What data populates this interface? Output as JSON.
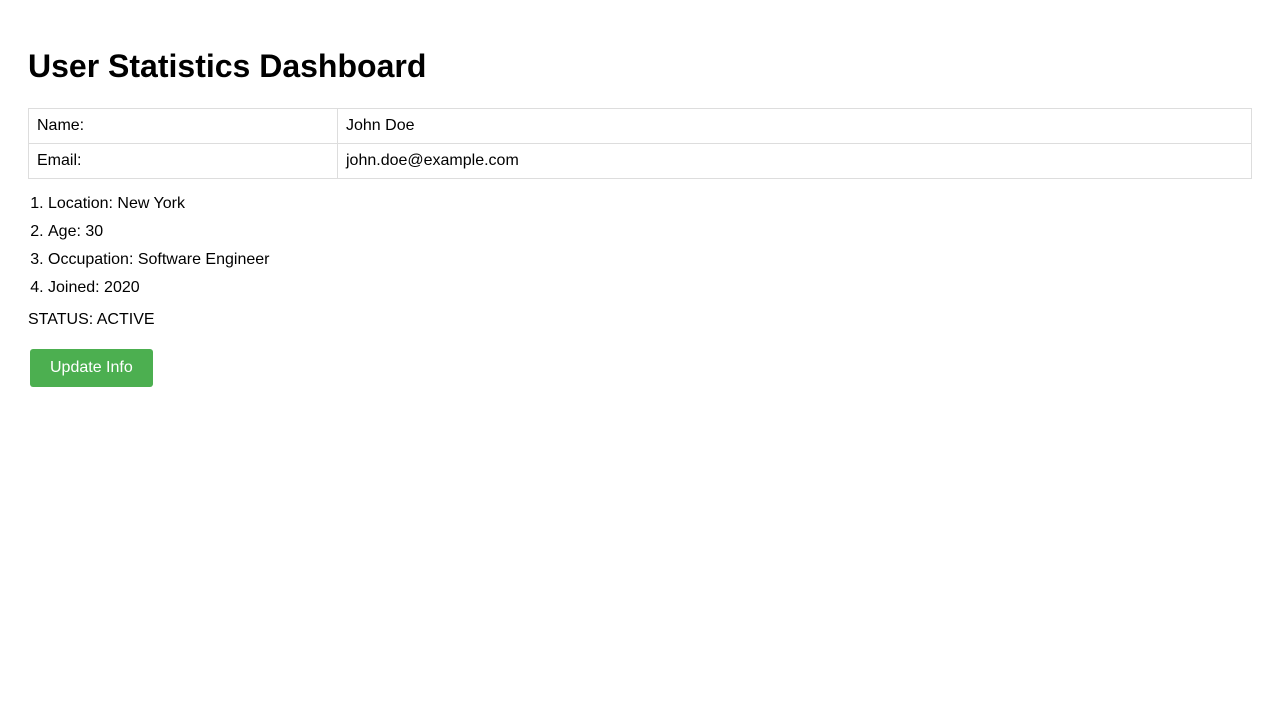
{
  "page": {
    "title": "User Statistics Dashboard"
  },
  "user_table": {
    "rows": [
      {
        "label": "Name:",
        "value": "John Doe"
      },
      {
        "label": "Email:",
        "value": "john.doe@example.com"
      }
    ]
  },
  "details": {
    "items": [
      "Location: New York",
      "Age: 30",
      "Occupation: Software Engineer",
      "Joined: 2020"
    ]
  },
  "status": {
    "text": "STATUS: ACTIVE"
  },
  "actions": {
    "update_label": "Update Info"
  },
  "colors": {
    "button_background": "#4caf50",
    "button_text": "#ffffff",
    "table_border": "#dddddd"
  }
}
